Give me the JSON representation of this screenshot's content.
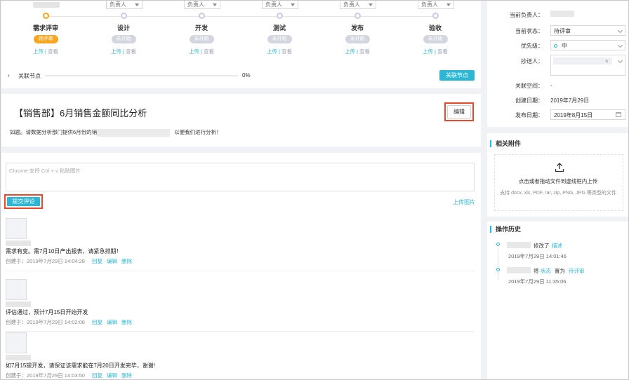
{
  "workflow": {
    "assignee_placeholder": "负责人",
    "steps": [
      {
        "name": "需求评审",
        "status": "待评审",
        "upload": "上传",
        "view": "查看"
      },
      {
        "name": "设计",
        "status": "未开始",
        "upload": "上传",
        "view": "查看"
      },
      {
        "name": "开发",
        "status": "未开始",
        "upload": "上传",
        "view": "查看"
      },
      {
        "name": "测试",
        "status": "未开始",
        "upload": "上传",
        "view": "查看"
      },
      {
        "name": "发布",
        "status": "未开始",
        "upload": "上传",
        "view": "查看"
      },
      {
        "name": "验收",
        "status": "未开始",
        "upload": "上传",
        "view": "查看"
      }
    ],
    "separator": "|",
    "assoc_label": "关联节点",
    "assoc_percent": "0%",
    "assoc_progress": 0,
    "assoc_button": "关联节点"
  },
  "task": {
    "title": "【销售部】6月销售金额同比分析",
    "edit_button": "编辑",
    "desc_prefix": "如题。请数据分析部门提供6月份的销",
    "desc_suffix": "以便我们进行分析！"
  },
  "comment_box": {
    "placeholder": "Chrome 支持 Ctrl + v 粘贴图片",
    "submit": "提交评论",
    "upload_image": "上传图片"
  },
  "comments": [
    {
      "text": "需求有变。需7月10日产出报表，请紧急排期！",
      "created": "创建于：2019年7月29日 14:04:28",
      "reply": "回复",
      "edit": "编辑",
      "delete": "删除"
    },
    {
      "text": "评估通过，预计7月15日开始开发",
      "created": "创建于：2019年7月29日 14:02:06",
      "reply": "回复",
      "edit": "编辑",
      "delete": "删除"
    },
    {
      "text": "如7月15提开发，请保证该需求能在7月20日开发完毕，谢谢!",
      "created": "创建于：2019年7月29日 14:03:50",
      "reply": "回复",
      "edit": "编辑",
      "delete": "删除"
    }
  ],
  "info": {
    "assignee_label": "当前负责人：",
    "status_label": "当前状态：",
    "status_value": "待评审",
    "priority_label": "优先级：",
    "priority_value": "中",
    "cc_label": "抄送人：",
    "cc_remove": "×",
    "space_label": "关联空间：",
    "space_value": "-",
    "created_label": "创建日期：",
    "created_value": "2019年7月29日",
    "release_label": "发布日期：",
    "release_value": "2019年8月15日"
  },
  "attachments": {
    "title": "相关附件",
    "drop_text": "点击或者拖动文件到虚线框内上传",
    "drop_hint": "支持 docx, xls, PDF, rar, zip, PNG, JPG 等类型的文件"
  },
  "history": {
    "title": "操作历史",
    "items": [
      {
        "action": "修改了",
        "target": "描述",
        "time": "2019年7月29日 14:01:46"
      },
      {
        "action": "将",
        "field": "状态",
        "mid": "置为",
        "target": "待评审",
        "time": "2019年7月29日 11:35:06"
      }
    ]
  },
  "colors": {
    "accent": "#2db7d5",
    "active_step": "#f5a623",
    "highlight_box": "#e7492b"
  }
}
